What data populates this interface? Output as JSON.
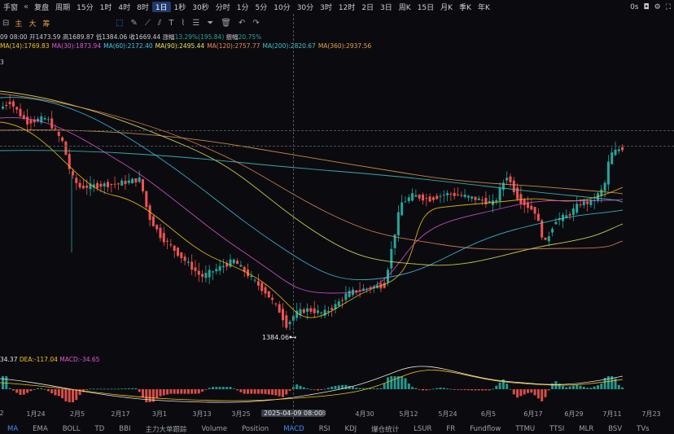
{
  "toolbar": {
    "left_partial": "手窗",
    "replay": "复盘",
    "period": "周期",
    "timeframes": [
      "15分",
      "1时",
      "4时",
      "8时",
      "1日",
      "1秒",
      "30秒",
      "分时",
      "1分",
      "5分",
      "10分",
      "30分",
      "3时",
      "12时",
      "2日",
      "3日",
      "周K",
      "15日",
      "月K",
      "季K",
      "年K"
    ],
    "active_timeframe": "1日",
    "indicator_tags": [
      "主",
      "大",
      "筹"
    ],
    "timezone": "0s"
  },
  "ohlc": {
    "date": "09 08:00",
    "open_label": "开",
    "open": "1473.59",
    "high_label": "高",
    "high": "1689.87",
    "low_label": "低",
    "low": "1384.06",
    "close_label": "收",
    "close": "1669.44",
    "change_label": "涨幅",
    "change": "13.29%(195.84)",
    "amp_label": "振幅",
    "amplitude": "20.75%"
  },
  "ma_legend": [
    {
      "label": "MA(14):1769.83",
      "color": "#f0c419"
    },
    {
      "label": "MA(30):1873.94",
      "color": "#e055d4"
    },
    {
      "label": "MA(60):2172.40",
      "color": "#3fc7e6"
    },
    {
      "label": "MA(90):2495.44",
      "color": "#e6e65a"
    },
    {
      "label": "MA(120):2757.77",
      "color": "#e68a5a"
    },
    {
      "label": "MA(200):2820.67",
      "color": "#44c4c4"
    },
    {
      "label": "MA(360):2937.56",
      "color": "#e6a04a"
    }
  ],
  "small_label": "3",
  "low_marker": "1384.06",
  "macd_legend": {
    "dif": "34.37",
    "dea": "DEA:-117.04",
    "macd": "MACD:-34.65"
  },
  "xaxis": [
    "2",
    "1月24",
    "2月5",
    "2月17",
    "3月1",
    "3月13",
    "3月25",
    "2025-04-09 08:00",
    "8",
    "4月30",
    "5月12",
    "5月24",
    "6月5",
    "6月17",
    "6月29",
    "7月11",
    "7月23"
  ],
  "bottom_tabs": [
    "MA",
    "EMA",
    "BOLL",
    "TD",
    "BBI",
    "主力大单跟踪",
    "Volume",
    "Position",
    "MACD",
    "RSI",
    "KDJ",
    "爆仓统计",
    "LSUR",
    "FR",
    "Fundflow",
    "TTMU",
    "TTSI",
    "MLR",
    "BSV",
    "TVs"
  ],
  "active_main": "MA",
  "active_sub": "MACD",
  "colors": {
    "up": "#26a69a",
    "down": "#ef5350",
    "accent": "#3d8cff"
  },
  "chart_data": {
    "type": "candlestick",
    "title": "",
    "ylabel": "",
    "annotations": [
      "1384.06"
    ],
    "x": [
      "1月24",
      "2月5",
      "2月17",
      "3月1",
      "3月13",
      "3月25",
      "2025-04-09 08:00",
      "4月30",
      "5月12",
      "5月24",
      "6月5",
      "6月17",
      "6月29",
      "7月11",
      "7月23"
    ],
    "series": [
      {
        "name": "MA(14)",
        "value": 1769.83
      },
      {
        "name": "MA(30)",
        "value": 1873.94
      },
      {
        "name": "MA(60)",
        "value": 2172.4
      },
      {
        "name": "MA(90)",
        "value": 2495.44
      },
      {
        "name": "MA(120)",
        "value": 2757.77
      },
      {
        "name": "MA(200)",
        "value": 2820.67
      },
      {
        "name": "MA(360)",
        "value": 2937.56
      }
    ]
  }
}
